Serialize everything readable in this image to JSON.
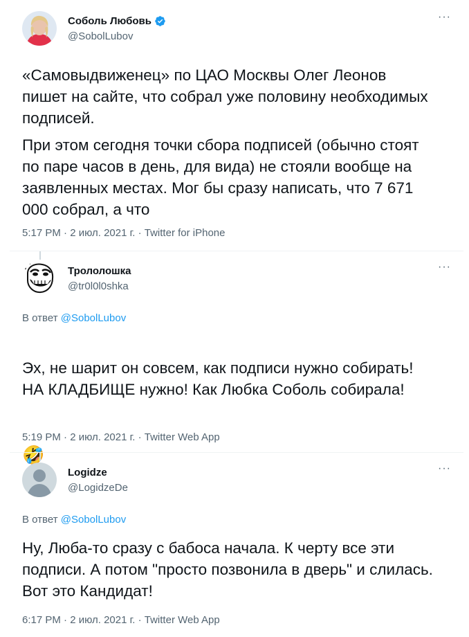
{
  "tweets": [
    {
      "author_name": "Соболь Любовь",
      "handle": "@SobolLubov",
      "verified": true,
      "menu_icon": "more-dots-icon",
      "text_p1": "«Самовыдвиженец» по ЦАО Москвы Олег Леонов пишет на сайте, что собрал уже половину необходимых подписей.",
      "text_p2": "При этом сегодня точки сбора подписей (обычно стоят по паре часов в день, для вида) не стояли вообще на заявленных местах. Мог бы сразу написать, что 7 671 000 собрал, а что",
      "meta": "5:17 PM · 2 июл. 2021 г. · Twitter for iPhone"
    },
    {
      "author_name": "Трололошка",
      "handle": "@tr0l0l0shka",
      "menu_icon": "more-dots-icon",
      "reply_prefix": "В ответ",
      "reply_handle": "@SobolLubov",
      "text": "Эх, не шарит он совсем, как подписи нужно собирать!\nНА КЛАДБИЩЕ нужно! Как Любка Соболь собирала!",
      "emoji": "🤣",
      "meta": "5:19 PM · 2 июл. 2021 г. · Twitter Web App"
    },
    {
      "author_name": "Logidze",
      "handle": "@LogidzeDe",
      "menu_icon": "more-dots-icon",
      "reply_prefix": "В ответ",
      "reply_handle": "@SobolLubov",
      "text": "Ну, Люба-то сразу с бабоса начала. К черту все эти подписи. А потом \"просто позвонила в дверь\" и слилась. Вот это Кандидат!",
      "meta": "6:17 PM · 2 июл. 2021 г. · Twitter Web App"
    }
  ],
  "colors": {
    "text": "#0f1419",
    "secondary": "#536471",
    "link": "#1d9bf0",
    "verified": "#1d9bf0",
    "divider": "#eff3f4"
  }
}
